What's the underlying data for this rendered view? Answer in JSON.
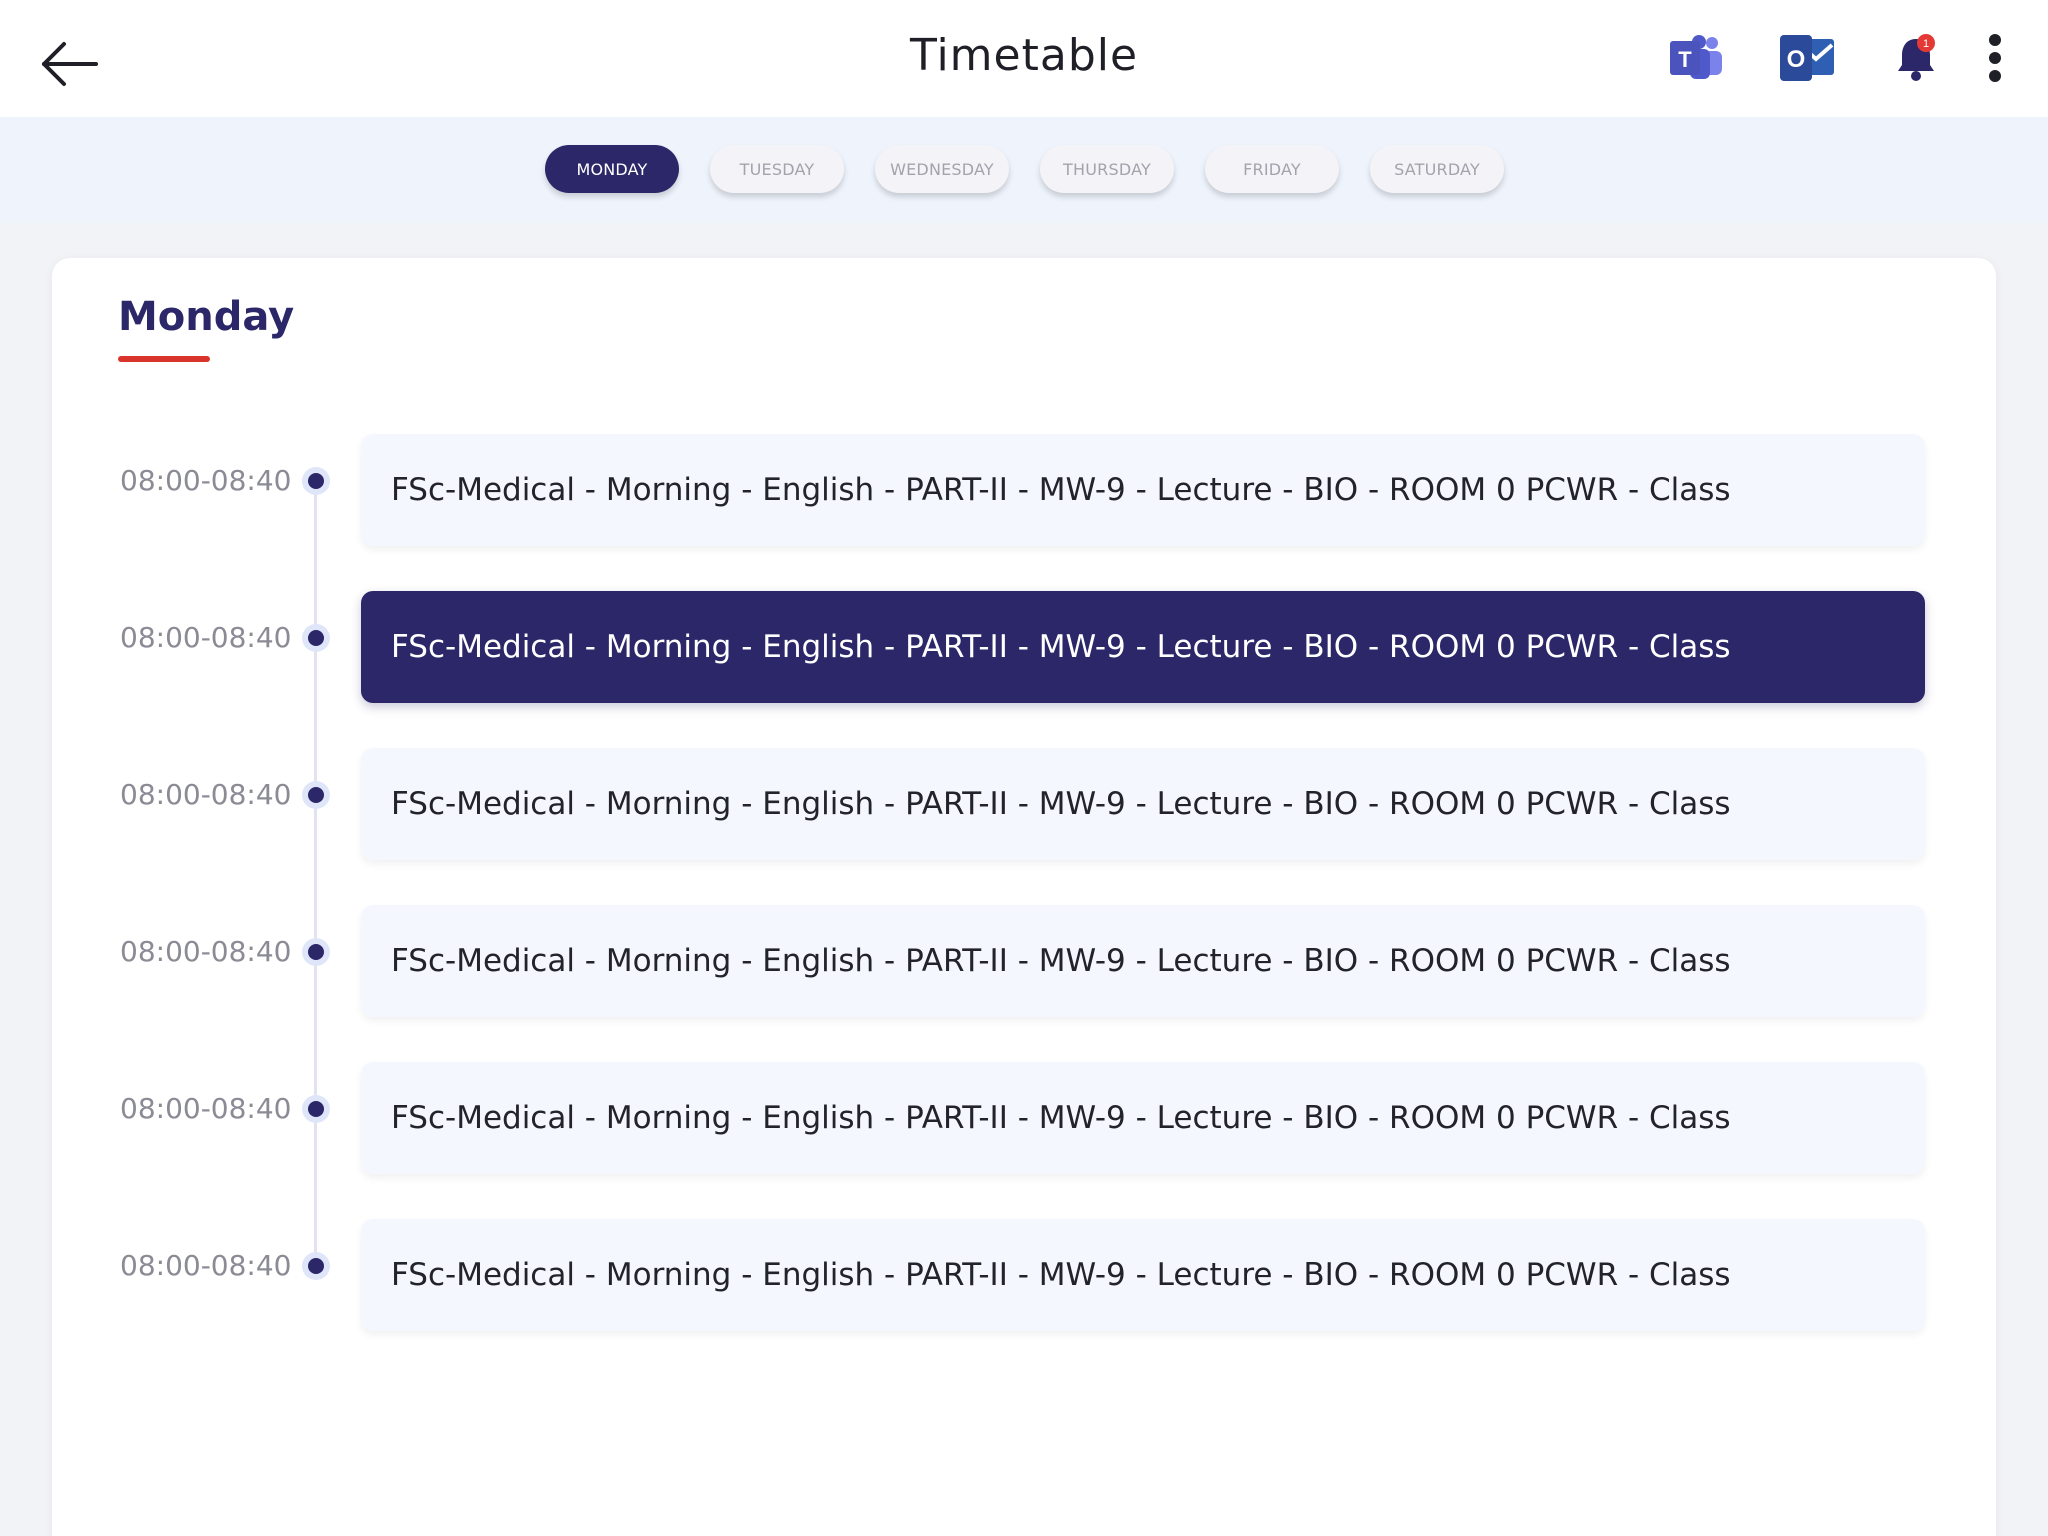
{
  "header": {
    "title": "Timetable",
    "icons": [
      "back-arrow-icon",
      "teams-icon",
      "outlook-icon",
      "bell-icon",
      "more-vert-icon"
    ],
    "teams_letter": "T",
    "outlook_letter": "O",
    "notification_count": "1"
  },
  "days": [
    {
      "label": "MONDAY",
      "active": true
    },
    {
      "label": "TUESDAY",
      "active": false
    },
    {
      "label": "WEDNESDAY",
      "active": false
    },
    {
      "label": "THURSDAY",
      "active": false
    },
    {
      "label": "FRIDAY",
      "active": false
    },
    {
      "label": "SATURDAY",
      "active": false
    }
  ],
  "schedule": {
    "day_title": "Monday",
    "slots": [
      {
        "time": "08:00-08:40",
        "text": "FSc-Medical - Morning - English - PART-II - MW-9 - Lecture - BIO - ROOM 0 PCWR - Class",
        "active": false
      },
      {
        "time": "08:00-08:40",
        "text": "FSc-Medical - Morning - English - PART-II - MW-9 - Lecture - BIO - ROOM 0 PCWR - Class",
        "active": true
      },
      {
        "time": "08:00-08:40",
        "text": "FSc-Medical - Morning - English - PART-II - MW-9 - Lecture - BIO - ROOM 0 PCWR - Class",
        "active": false
      },
      {
        "time": "08:00-08:40",
        "text": "FSc-Medical - Morning - English - PART-II - MW-9 - Lecture - BIO - ROOM 0 PCWR - Class",
        "active": false
      },
      {
        "time": "08:00-08:40",
        "text": "FSc-Medical - Morning - English - PART-II - MW-9 - Lecture - BIO - ROOM 0 PCWR - Class",
        "active": false
      },
      {
        "time": "08:00-08:40",
        "text": "FSc-Medical - Morning - English - PART-II - MW-9 - Lecture - BIO - ROOM 0 PCWR - Class",
        "active": false
      }
    ]
  },
  "colors": {
    "primary": "#2b2768",
    "accent_red": "#d9342b",
    "card_bg": "#f4f8fe",
    "teams_purple": "#4b53bc",
    "outlook_blue": "#2f4f9f",
    "bell_navy": "#2b2768",
    "badge_red": "#e53935"
  }
}
